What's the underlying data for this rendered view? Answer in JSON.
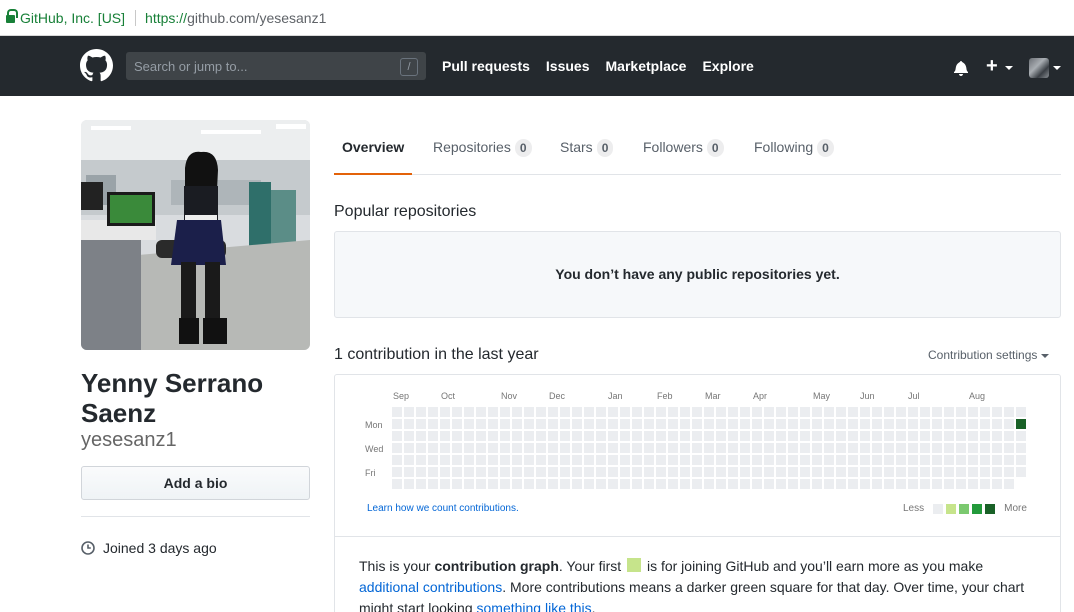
{
  "browser": {
    "org_label": "GitHub, Inc. [US]",
    "url_proto": "https://",
    "url_rest": "github.com/yesesanz1"
  },
  "header": {
    "search_placeholder": "Search or jump to...",
    "search_shortcut": "/",
    "nav": [
      "Pull requests",
      "Issues",
      "Marketplace",
      "Explore"
    ],
    "plus_label": "+"
  },
  "profile": {
    "name": "Yenny Serrano Saenz",
    "login": "yesesanz1",
    "bio_button": "Add a bio",
    "joined": "Joined 3 days ago"
  },
  "tabs": [
    {
      "label": "Overview",
      "count": null,
      "selected": true
    },
    {
      "label": "Repositories",
      "count": "0"
    },
    {
      "label": "Stars",
      "count": "0"
    },
    {
      "label": "Followers",
      "count": "0"
    },
    {
      "label": "Following",
      "count": "0"
    }
  ],
  "popular": {
    "title": "Popular repositories",
    "empty": "You don’t have any public repositories yet."
  },
  "contrib": {
    "title": "1 contribution in the last year",
    "settings": "Contribution settings",
    "months": [
      "Sep",
      "Oct",
      "Nov",
      "Dec",
      "Jan",
      "Feb",
      "Mar",
      "Apr",
      "May",
      "Jun",
      "Jul",
      "Aug"
    ],
    "days": [
      "Mon",
      "Wed",
      "Fri"
    ],
    "learn_link": "Learn how we count contributions.",
    "legend_less": "Less",
    "legend_more": "More",
    "colors": [
      "#ebedf0",
      "#c6e48b",
      "#7bc96f",
      "#239a3b",
      "#196127"
    ],
    "weeks": 53,
    "last_week_days": 6,
    "contributions": [
      {
        "week": 52,
        "day": 1,
        "level": 4
      }
    ]
  },
  "info": {
    "p1": "This is your ",
    "p1_bold": "contribution graph",
    "p2": ". Your first ",
    "p3": " is for joining GitHub and you’ll earn more as you make",
    "link1": "additional contributions",
    "p4": ". More contributions means a darker green square for that day. Over time, your chart",
    "p5": "might start looking ",
    "link2": "something like this",
    "p6": "."
  }
}
